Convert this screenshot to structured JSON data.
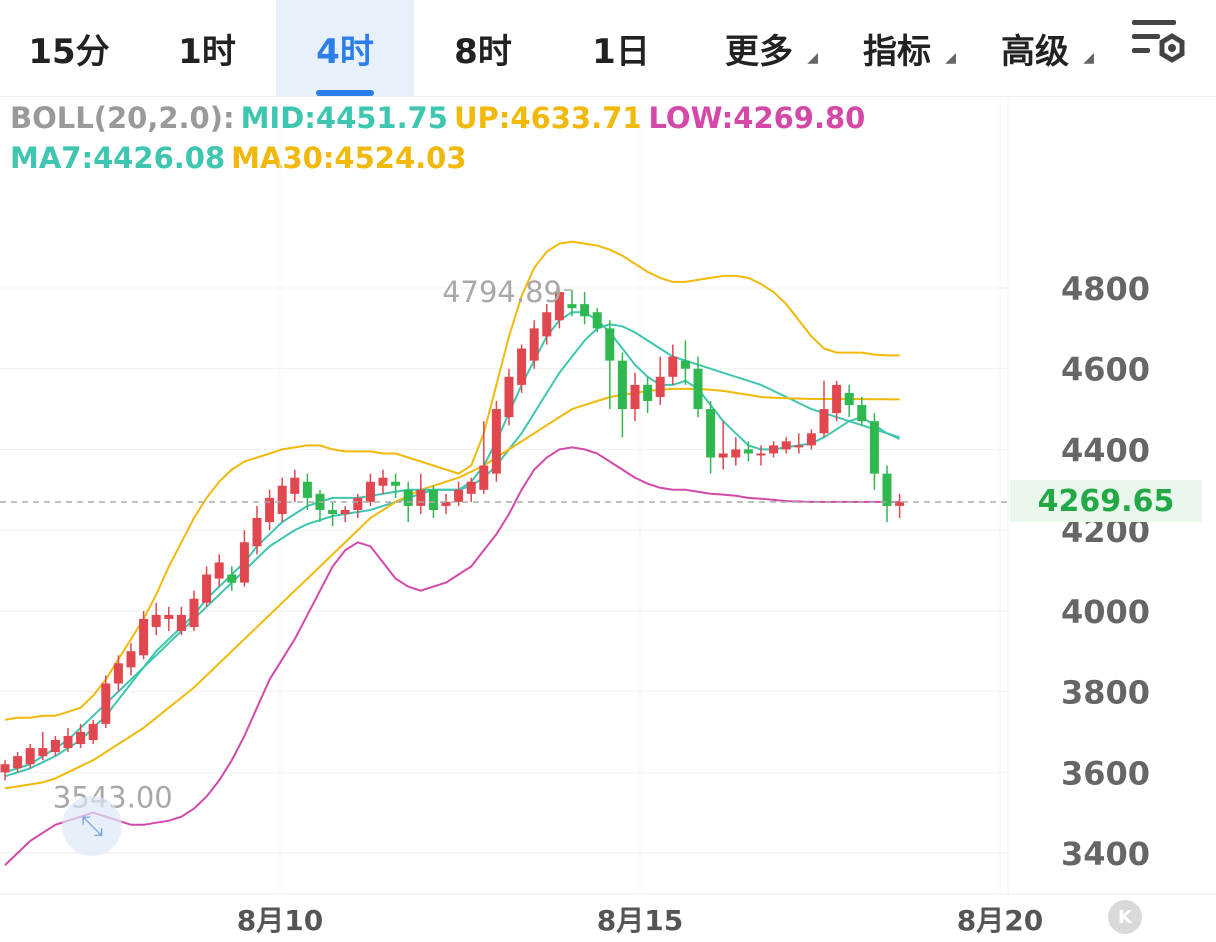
{
  "toolbar": {
    "tabs": [
      {
        "label": "15分"
      },
      {
        "label": "1时"
      },
      {
        "label": "4时"
      },
      {
        "label": "8时"
      },
      {
        "label": "1日"
      },
      {
        "label": "更多"
      },
      {
        "label": "指标"
      },
      {
        "label": "高级"
      }
    ],
    "active_tab": "4时",
    "settings_icon": "chart-settings-icon"
  },
  "legend": {
    "boll_label": "BOLL(20,2.0):",
    "mid": "MID:4451.75",
    "up": "UP:4633.71",
    "low": "LOW:4269.80",
    "ma7": "MA7:4426.08",
    "ma30": "MA30:4524.03"
  },
  "colors": {
    "up_candle": "#e0474f",
    "down_candle": "#2fb84f",
    "mid": "#3fc6b0",
    "upper": "#f0b90b",
    "lower": "#d349a8",
    "ma7": "#3fc6b0",
    "ma30": "#f0b90b",
    "active_tab": "#2b7de9"
  },
  "current_price": "4269.65",
  "chart_data": {
    "type": "candlestick",
    "ylim": [
      3300,
      5000
    ],
    "y_ticks": [
      "4800",
      "4600",
      "4400",
      "4200",
      "4000",
      "3800",
      "3600",
      "3400"
    ],
    "x_ticks": [
      "8月10",
      "8月15",
      "8月20"
    ],
    "high_label": "4794.89",
    "low_label": "3543.00",
    "candles": [
      [
        3600,
        3620,
        3580,
        3630
      ],
      [
        3610,
        3640,
        3600,
        3650
      ],
      [
        3620,
        3660,
        3610,
        3670
      ],
      [
        3640,
        3660,
        3630,
        3700
      ],
      [
        3650,
        3680,
        3640,
        3690
      ],
      [
        3660,
        3690,
        3650,
        3710
      ],
      [
        3670,
        3700,
        3660,
        3720
      ],
      [
        3680,
        3720,
        3670,
        3730
      ],
      [
        3720,
        3820,
        3710,
        3840
      ],
      [
        3820,
        3870,
        3800,
        3890
      ],
      [
        3860,
        3900,
        3840,
        3920
      ],
      [
        3890,
        3980,
        3880,
        4000
      ],
      [
        3960,
        3990,
        3940,
        4020
      ],
      [
        3980,
        3990,
        3950,
        4010
      ],
      [
        3950,
        3990,
        3940,
        4010
      ],
      [
        3960,
        4030,
        3950,
        4050
      ],
      [
        4020,
        4090,
        4010,
        4110
      ],
      [
        4080,
        4120,
        4060,
        4140
      ],
      [
        4090,
        4070,
        4050,
        4110
      ],
      [
        4070,
        4170,
        4060,
        4200
      ],
      [
        4160,
        4230,
        4140,
        4260
      ],
      [
        4220,
        4280,
        4200,
        4300
      ],
      [
        4240,
        4310,
        4220,
        4330
      ],
      [
        4290,
        4330,
        4270,
        4350
      ],
      [
        4320,
        4280,
        4250,
        4340
      ],
      [
        4290,
        4250,
        4220,
        4300
      ],
      [
        4250,
        4240,
        4210,
        4270
      ],
      [
        4240,
        4250,
        4220,
        4260
      ],
      [
        4250,
        4280,
        4230,
        4290
      ],
      [
        4270,
        4320,
        4260,
        4340
      ],
      [
        4310,
        4330,
        4290,
        4350
      ],
      [
        4320,
        4310,
        4280,
        4340
      ],
      [
        4300,
        4260,
        4220,
        4320
      ],
      [
        4260,
        4300,
        4240,
        4340
      ],
      [
        4300,
        4250,
        4230,
        4310
      ],
      [
        4260,
        4270,
        4240,
        4290
      ],
      [
        4270,
        4300,
        4260,
        4320
      ],
      [
        4290,
        4320,
        4270,
        4330
      ],
      [
        4300,
        4360,
        4290,
        4470
      ],
      [
        4340,
        4500,
        4320,
        4520
      ],
      [
        4480,
        4580,
        4460,
        4600
      ],
      [
        4560,
        4650,
        4540,
        4660
      ],
      [
        4620,
        4700,
        4600,
        4720
      ],
      [
        4680,
        4740,
        4660,
        4760
      ],
      [
        4720,
        4790,
        4700,
        4790
      ],
      [
        4760,
        4750,
        4730,
        4795
      ],
      [
        4760,
        4730,
        4710,
        4790
      ],
      [
        4740,
        4700,
        4690,
        4750
      ],
      [
        4700,
        4620,
        4500,
        4720
      ],
      [
        4620,
        4500,
        4430,
        4640
      ],
      [
        4500,
        4560,
        4470,
        4590
      ],
      [
        4560,
        4520,
        4490,
        4580
      ],
      [
        4530,
        4580,
        4510,
        4630
      ],
      [
        4580,
        4630,
        4560,
        4660
      ],
      [
        4620,
        4600,
        4560,
        4670
      ],
      [
        4600,
        4500,
        4480,
        4630
      ],
      [
        4500,
        4380,
        4340,
        4520
      ],
      [
        4380,
        4390,
        4350,
        4470
      ],
      [
        4380,
        4400,
        4360,
        4430
      ],
      [
        4400,
        4390,
        4370,
        4420
      ],
      [
        4390,
        4390,
        4360,
        4410
      ],
      [
        4390,
        4410,
        4380,
        4420
      ],
      [
        4400,
        4420,
        4390,
        4430
      ],
      [
        4410,
        4410,
        4390,
        4440
      ],
      [
        4410,
        4440,
        4400,
        4450
      ],
      [
        4440,
        4500,
        4430,
        4570
      ],
      [
        4490,
        4560,
        4470,
        4570
      ],
      [
        4540,
        4510,
        4480,
        4560
      ],
      [
        4510,
        4470,
        4460,
        4530
      ],
      [
        4470,
        4340,
        4300,
        4490
      ],
      [
        4340,
        4260,
        4220,
        4360
      ],
      [
        4260,
        4270,
        4230,
        4290
      ]
    ],
    "boll_mid": [
      3600,
      3610,
      3620,
      3640,
      3660,
      3680,
      3710,
      3740,
      3770,
      3800,
      3830,
      3860,
      3890,
      3920,
      3950,
      3980,
      4010,
      4040,
      4070,
      4100,
      4130,
      4160,
      4180,
      4200,
      4215,
      4225,
      4235,
      4240,
      4245,
      4250,
      4260,
      4270,
      4280,
      4290,
      4300,
      4300,
      4300,
      4310,
      4330,
      4360,
      4400,
      4440,
      4490,
      4540,
      4590,
      4630,
      4670,
      4700,
      4710,
      4705,
      4690,
      4670,
      4650,
      4630,
      4620,
      4610,
      4600,
      4590,
      4580,
      4570,
      4560,
      4545,
      4530,
      4515,
      4500,
      4490,
      4480,
      4470,
      4460,
      4450,
      4440,
      4430
    ],
    "boll_upper": [
      3730,
      3735,
      3735,
      3740,
      3740,
      3750,
      3760,
      3790,
      3830,
      3880,
      3930,
      3980,
      4040,
      4110,
      4170,
      4230,
      4280,
      4320,
      4350,
      4370,
      4380,
      4390,
      4400,
      4405,
      4410,
      4410,
      4400,
      4395,
      4395,
      4395,
      4390,
      4390,
      4380,
      4370,
      4360,
      4350,
      4340,
      4360,
      4440,
      4560,
      4680,
      4780,
      4850,
      4890,
      4910,
      4915,
      4910,
      4905,
      4895,
      4880,
      4860,
      4840,
      4825,
      4815,
      4815,
      4820,
      4825,
      4830,
      4830,
      4825,
      4810,
      4790,
      4760,
      4720,
      4680,
      4650,
      4640,
      4640,
      4640,
      4635,
      4633,
      4633
    ],
    "boll_lower": [
      3370,
      3400,
      3430,
      3450,
      3470,
      3480,
      3490,
      3500,
      3490,
      3480,
      3470,
      3470,
      3475,
      3480,
      3490,
      3510,
      3540,
      3580,
      3630,
      3690,
      3760,
      3830,
      3880,
      3930,
      3990,
      4050,
      4110,
      4150,
      4170,
      4160,
      4120,
      4080,
      4060,
      4050,
      4060,
      4070,
      4090,
      4110,
      4150,
      4190,
      4240,
      4300,
      4350,
      4380,
      4400,
      4405,
      4400,
      4390,
      4370,
      4350,
      4330,
      4315,
      4305,
      4300,
      4300,
      4295,
      4290,
      4288,
      4285,
      4280,
      4278,
      4275,
      4272,
      4271,
      4270,
      4270,
      4270,
      4270,
      4270,
      4270,
      4270,
      4269.8
    ],
    "ma7": [
      3590,
      3600,
      3610,
      3625,
      3640,
      3660,
      3680,
      3710,
      3740,
      3780,
      3820,
      3860,
      3900,
      3930,
      3960,
      3990,
      4030,
      4060,
      4090,
      4120,
      4160,
      4190,
      4220,
      4240,
      4260,
      4270,
      4280,
      4280,
      4280,
      4285,
      4290,
      4295,
      4300,
      4300,
      4300,
      4300,
      4300,
      4320,
      4360,
      4420,
      4490,
      4560,
      4620,
      4680,
      4720,
      4740,
      4740,
      4720,
      4690,
      4650,
      4610,
      4580,
      4560,
      4560,
      4570,
      4550,
      4510,
      4470,
      4440,
      4410,
      4400,
      4400,
      4405,
      4410,
      4415,
      4430,
      4450,
      4470,
      4480,
      4460,
      4440,
      4426.08
    ],
    "ma30": [
      3560,
      3565,
      3570,
      3575,
      3585,
      3600,
      3615,
      3630,
      3650,
      3670,
      3690,
      3710,
      3735,
      3760,
      3785,
      3810,
      3840,
      3870,
      3900,
      3930,
      3960,
      3990,
      4020,
      4050,
      4080,
      4110,
      4140,
      4170,
      4200,
      4230,
      4250,
      4270,
      4285,
      4300,
      4310,
      4320,
      4330,
      4345,
      4360,
      4380,
      4400,
      4420,
      4440,
      4460,
      4480,
      4500,
      4510,
      4520,
      4530,
      4535,
      4540,
      4545,
      4548,
      4550,
      4550,
      4550,
      4548,
      4545,
      4540,
      4535,
      4530,
      4528,
      4527,
      4526,
      4525,
      4525,
      4525,
      4525,
      4525,
      4524.5,
      4524.2,
      4524.03
    ]
  }
}
